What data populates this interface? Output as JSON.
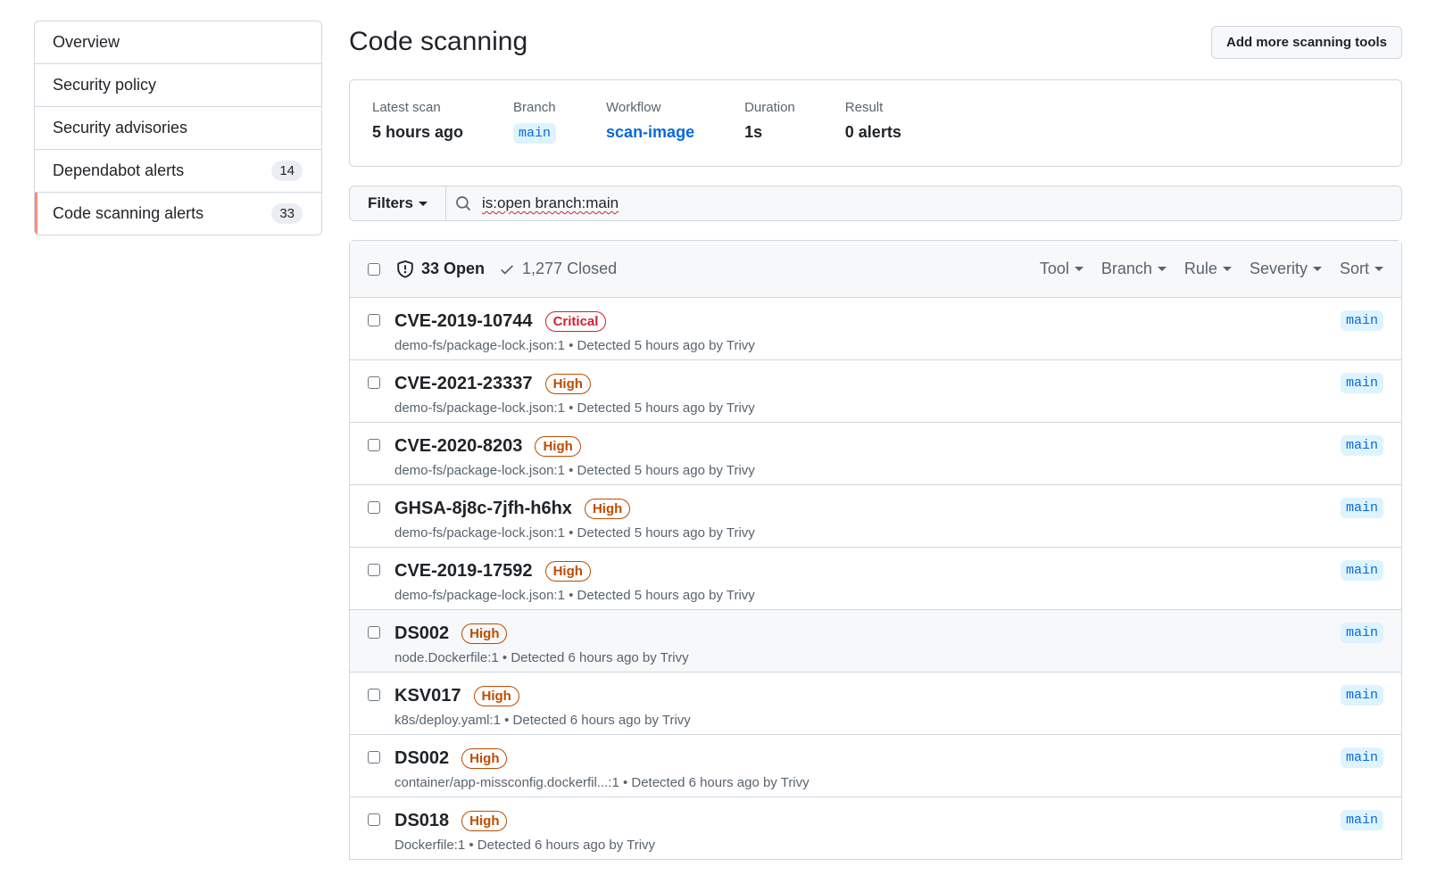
{
  "sidebar": {
    "items": [
      {
        "label": "Overview",
        "count": ""
      },
      {
        "label": "Security policy",
        "count": ""
      },
      {
        "label": "Security advisories",
        "count": ""
      },
      {
        "label": "Dependabot alerts",
        "count": "14"
      },
      {
        "label": "Code scanning alerts",
        "count": "33"
      }
    ]
  },
  "header": {
    "title": "Code scanning",
    "add_tools_label": "Add more scanning tools"
  },
  "scan": {
    "latest_label": "Latest scan",
    "latest_value": "5 hours ago",
    "branch_label": "Branch",
    "branch_value": "main",
    "workflow_label": "Workflow",
    "workflow_value": "scan-image",
    "duration_label": "Duration",
    "duration_value": "1s",
    "result_label": "Result",
    "result_value": "0 alerts"
  },
  "filter": {
    "filters_label": "Filters",
    "query": "is:open branch:main"
  },
  "list_header": {
    "open_label": "33 Open",
    "closed_label": "1,277 Closed",
    "tool": "Tool",
    "branch": "Branch",
    "rule": "Rule",
    "severity": "Severity",
    "sort": "Sort"
  },
  "alerts": [
    {
      "id": "CVE-2019-10744",
      "severity": "Critical",
      "sub": "demo-fs/package-lock.json:1 • Detected 5 hours ago by Trivy",
      "branch": "main"
    },
    {
      "id": "CVE-2021-23337",
      "severity": "High",
      "sub": "demo-fs/package-lock.json:1 • Detected 5 hours ago by Trivy",
      "branch": "main"
    },
    {
      "id": "CVE-2020-8203",
      "severity": "High",
      "sub": "demo-fs/package-lock.json:1 • Detected 5 hours ago by Trivy",
      "branch": "main"
    },
    {
      "id": "GHSA-8j8c-7jfh-h6hx",
      "severity": "High",
      "sub": "demo-fs/package-lock.json:1 • Detected 5 hours ago by Trivy",
      "branch": "main"
    },
    {
      "id": "CVE-2019-17592",
      "severity": "High",
      "sub": "demo-fs/package-lock.json:1 • Detected 5 hours ago by Trivy",
      "branch": "main"
    },
    {
      "id": "DS002",
      "severity": "High",
      "sub": "node.Dockerfile:1 • Detected 6 hours ago by Trivy",
      "branch": "main"
    },
    {
      "id": "KSV017",
      "severity": "High",
      "sub": "k8s/deploy.yaml:1 • Detected 6 hours ago by Trivy",
      "branch": "main"
    },
    {
      "id": "DS002",
      "severity": "High",
      "sub": "container/app-missconfig.dockerfil...:1 • Detected 6 hours ago by Trivy",
      "branch": "main"
    },
    {
      "id": "DS018",
      "severity": "High",
      "sub": "Dockerfile:1 • Detected 6 hours ago by Trivy",
      "branch": "main"
    }
  ]
}
